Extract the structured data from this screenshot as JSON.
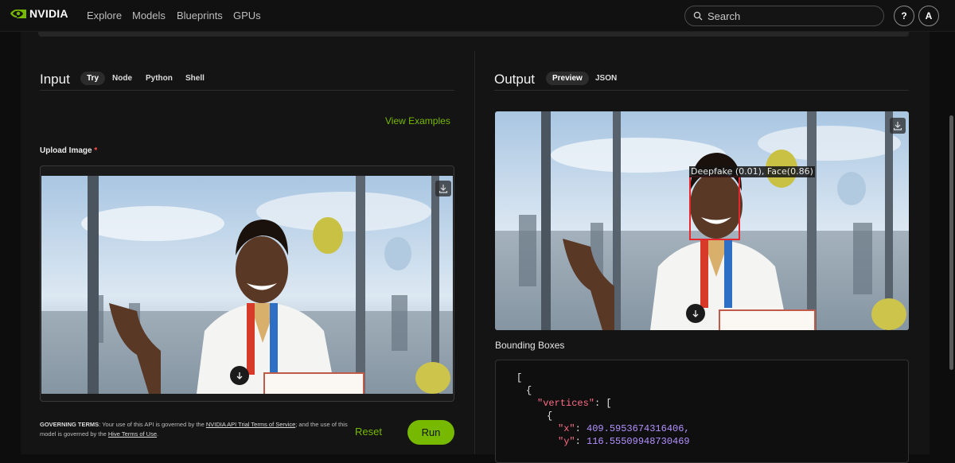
{
  "nav": {
    "brand": "NVIDIA",
    "links": [
      "Explore",
      "Models",
      "Blueprints",
      "GPUs"
    ],
    "search_placeholder": "Search",
    "help_label": "?",
    "avatar_initial": "A"
  },
  "input": {
    "title": "Input",
    "tabs": [
      "Try",
      "Node",
      "Python",
      "Shell"
    ],
    "active_tab": "Try",
    "view_examples": "View Examples",
    "upload_label": "Upload Image",
    "required_mark": "*"
  },
  "output": {
    "title": "Output",
    "tabs": [
      "Preview",
      "JSON"
    ],
    "active_tab": "Preview",
    "detection_label": "Deepfake (0.01), Face(0.86)",
    "bounding_boxes_label": "Bounding Boxes"
  },
  "json_preview": {
    "open_bracket": "[",
    "open_brace": "{",
    "vertices_key": "\"vertices\"",
    "vertices_open": "[",
    "vertex_open": "{",
    "x_key": "\"x\"",
    "x_value": "409.5953674316406,",
    "y_key": "\"y\"",
    "y_value": "116.55509948730469"
  },
  "footer": {
    "governing_title": "GOVERNING TERMS",
    "text_1": ": Your use of this API is governed by the ",
    "link_1": "NVIDIA API Trial Terms of Service",
    "text_2": "; and the use of this model is governed by the ",
    "link_2": "Hive Terms of Use",
    "text_3": ".",
    "reset_label": "Reset",
    "run_label": "Run"
  },
  "colors": {
    "accent": "#76b900",
    "json_key": "#ff6b86",
    "json_number": "#b391ff",
    "detection_box": "#e8262d"
  }
}
